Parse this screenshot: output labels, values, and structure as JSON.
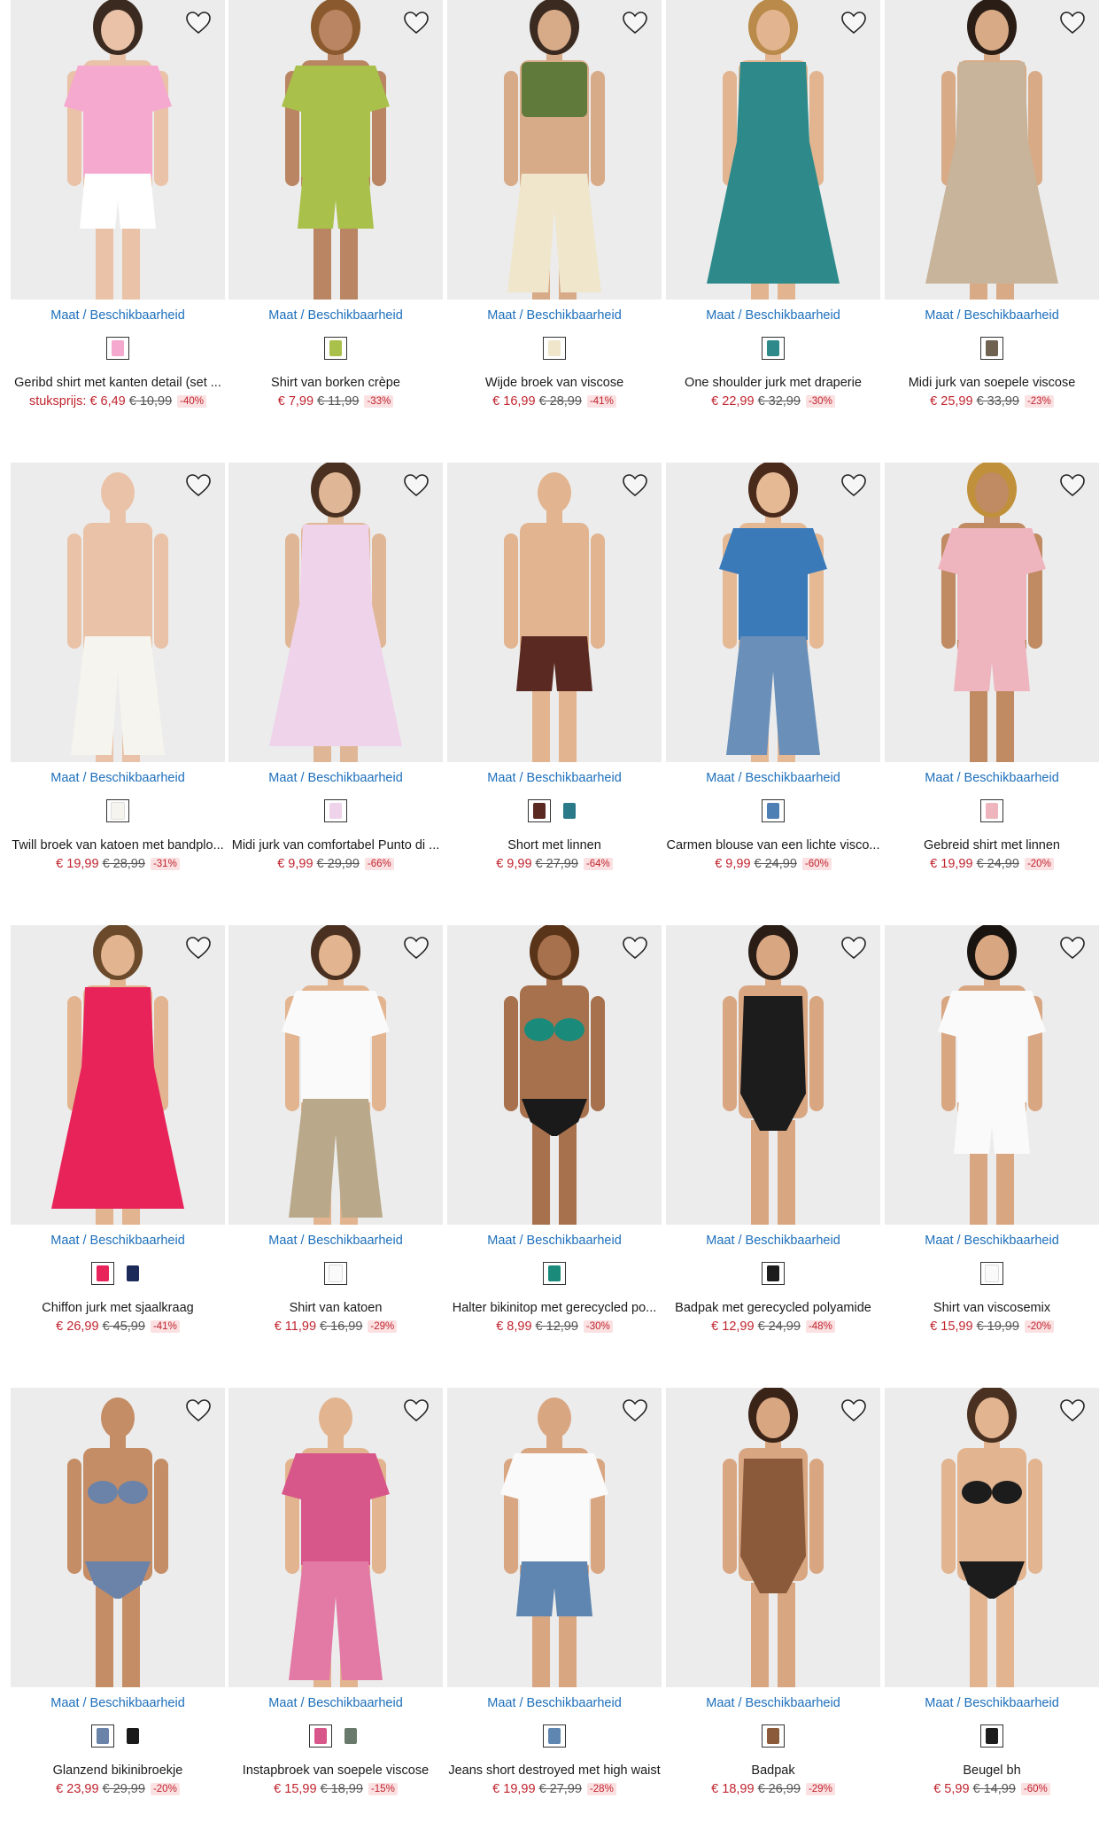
{
  "maat_label": "Maat / Beschikbaarheid",
  "colors": {
    "price_red": "#c0242e",
    "link_blue": "#1d6fbb",
    "discount_bg": "#fbe1e2"
  },
  "products": [
    {
      "name": "Geribd shirt met kanten detail (set ...",
      "prefix": "stuksprijs:",
      "price": "€ 6,49",
      "old_price": "€ 10,99",
      "discount": "-40%",
      "bg": "#ececec",
      "skin": "#e9c2a7",
      "hair": "#3a2a20",
      "top": "#f6a9cf",
      "bottom": "#ffffff",
      "bottom_type": "shorts",
      "top_type": "tee",
      "swatches": [
        "#f6a9cf"
      ]
    },
    {
      "name": "Shirt van borken crèpe",
      "price": "€ 7,99",
      "old_price": "€ 11,99",
      "discount": "-33%",
      "bg": "#ececec",
      "skin": "#b98562",
      "hair": "#8a5a2e",
      "top": "#a9c04a",
      "bottom": "#a9c04a",
      "bottom_type": "shorts",
      "top_type": "tee",
      "swatches": [
        "#a9c04a"
      ]
    },
    {
      "name": "Wijde broek van viscose",
      "price": "€ 16,99",
      "old_price": "€ 28,99",
      "discount": "-41%",
      "bg": "#ececec",
      "skin": "#d7aa88",
      "hair": "#3a2a20",
      "top": "#5f7a3a",
      "bottom": "#efe6cc",
      "bottom_type": "pants",
      "top_type": "cropped",
      "swatches": [
        "#efe6cc"
      ]
    },
    {
      "name": "One shoulder jurk met draperie",
      "price": "€ 22,99",
      "old_price": "€ 32,99",
      "discount": "-30%",
      "bg": "#ececec",
      "skin": "#e2b48f",
      "hair": "#b98a4a",
      "top": "#2e8a8a",
      "bottom": "#2e8a8a",
      "bottom_type": "dress",
      "top_type": "dress",
      "swatches": [
        "#2e8a8a"
      ]
    },
    {
      "name": "Midi jurk van soepele viscose",
      "price": "€ 25,99",
      "old_price": "€ 33,99",
      "discount": "-23%",
      "bg": "#ececec",
      "skin": "#d9aa86",
      "hair": "#2a1d16",
      "top": "#c7b49a",
      "bottom": "#5a4a3a",
      "bottom_type": "dress",
      "top_type": "dress",
      "swatches": [
        "#6f6250"
      ]
    },
    {
      "name": "Twill broek van katoen met bandplo...",
      "price": "€ 19,99",
      "old_price": "€ 28,99",
      "discount": "-31%",
      "bg": "#ececec",
      "skin": "#e9c2a7",
      "hair": "#ececec",
      "top": "#d8c3a5",
      "bottom": "#f6f4ee",
      "bottom_type": "pants",
      "top_type": "none",
      "swatches": [
        "#f6f4ee"
      ]
    },
    {
      "name": "Midi jurk van comfortabel Punto di ...",
      "price": "€ 9,99",
      "old_price": "€ 29,99",
      "discount": "-66%",
      "bg": "#ececec",
      "skin": "#e0b796",
      "hair": "#4a3020",
      "top": "#efd3ea",
      "bottom": "#efd3ea",
      "bottom_type": "dress",
      "top_type": "dress",
      "swatches": [
        "#efd3ea"
      ]
    },
    {
      "name": "Short met linnen",
      "price": "€ 9,99",
      "old_price": "€ 27,99",
      "discount": "-64%",
      "bg": "#ececec",
      "skin": "#e2b48f",
      "hair": "#ececec",
      "top": "#5a2a22",
      "bottom": "#5a2a22",
      "bottom_type": "shorts",
      "top_type": "none",
      "swatches": [
        "#5a2a22",
        "#2a7a8a"
      ]
    },
    {
      "name": "Carmen blouse van een lichte visco...",
      "price": "€ 9,99",
      "old_price": "€ 24,99",
      "discount": "-60%",
      "bg": "#ececec",
      "skin": "#e6b995",
      "hair": "#4a2a1a",
      "top": "#3a7ab8",
      "bottom": "#6a8fb8",
      "bottom_type": "pants",
      "top_type": "tee",
      "swatches": [
        "#4d7fb5"
      ]
    },
    {
      "name": "Gebreid shirt met linnen",
      "price": "€ 19,99",
      "old_price": "€ 24,99",
      "discount": "-20%",
      "bg": "#ececec",
      "skin": "#c08a62",
      "hair": "#c0903a",
      "top": "#eeb5be",
      "bottom": "#eeb5be",
      "bottom_type": "shorts",
      "top_type": "tee",
      "swatches": [
        "#eeb5be"
      ]
    },
    {
      "name": "Chiffon jurk met sjaalkraag",
      "price": "€ 26,99",
      "old_price": "€ 45,99",
      "discount": "-41%",
      "bg": "#ececec",
      "skin": "#e2b48f",
      "hair": "#6a4a2a",
      "top": "#e8235a",
      "bottom": "#e8235a",
      "bottom_type": "dress",
      "top_type": "dress",
      "swatches": [
        "#e8235a",
        "#1c2a5a"
      ]
    },
    {
      "name": "Shirt van katoen",
      "price": "€ 11,99",
      "old_price": "€ 16,99",
      "discount": "-29%",
      "bg": "#ececec",
      "skin": "#e2b48f",
      "hair": "#4a3020",
      "top": "#fafafa",
      "bottom": "#b9a98a",
      "bottom_type": "pants",
      "top_type": "tee",
      "swatches": [
        "#fafafa"
      ]
    },
    {
      "name": "Halter bikinitop met gerecycled po...",
      "price": "€ 8,99",
      "old_price": "€ 12,99",
      "discount": "-30%",
      "bg": "#ececec",
      "skin": "#a8714d",
      "hair": "#5a3418",
      "top": "#1a8a7a",
      "bottom": "#1a1a1a",
      "bottom_type": "bikini",
      "top_type": "bikini",
      "swatches": [
        "#1a8a7a"
      ]
    },
    {
      "name": "Badpak met gerecycled polyamide",
      "price": "€ 12,99",
      "old_price": "€ 24,99",
      "discount": "-48%",
      "bg": "#ececec",
      "skin": "#d9a682",
      "hair": "#2a1d16",
      "top": "#1c1c1c",
      "bottom": "#1c1c1c",
      "bottom_type": "swimsuit",
      "top_type": "swimsuit",
      "swatches": [
        "#1c1c1c"
      ]
    },
    {
      "name": "Shirt van viscosemix",
      "price": "€ 15,99",
      "old_price": "€ 19,99",
      "discount": "-20%",
      "bg": "#ececec",
      "skin": "#d9a682",
      "hair": "#1a1410",
      "top": "#fafafa",
      "bottom": "#fafafa",
      "bottom_type": "shorts",
      "top_type": "tee",
      "swatches": [
        "#fafafa"
      ]
    },
    {
      "name": "Glanzend bikinibroekje",
      "price": "€ 23,99",
      "old_price": "€ 29,99",
      "discount": "-20%",
      "bg": "#ececec",
      "skin": "#c48d66",
      "hair": "#ececec",
      "top": "#6b83a8",
      "bottom": "#6b83a8",
      "bottom_type": "bikini",
      "top_type": "bikini",
      "swatches": [
        "#6b83a8",
        "#1a1a1a"
      ]
    },
    {
      "name": "Instapbroek van soepele viscose",
      "price": "€ 15,99",
      "old_price": "€ 18,99",
      "discount": "-15%",
      "bg": "#ececec",
      "skin": "#e2b48f",
      "hair": "#ececec",
      "top": "#d8578a",
      "bottom": "#e27aa5",
      "bottom_type": "pants",
      "top_type": "tee",
      "swatches": [
        "#d8578a",
        "#6a7a6a"
      ]
    },
    {
      "name": "Jeans short destroyed met high waist",
      "price": "€ 19,99",
      "old_price": "€ 27,99",
      "discount": "-28%",
      "bg": "#ececec",
      "skin": "#d9a682",
      "hair": "#ececec",
      "top": "#fafafa",
      "bottom": "#5f86b0",
      "bottom_type": "shorts",
      "top_type": "tee",
      "swatches": [
        "#5f86b0"
      ]
    },
    {
      "name": "Badpak",
      "price": "€ 18,99",
      "old_price": "€ 26,99",
      "discount": "-29%",
      "bg": "#ececec",
      "skin": "#d9a682",
      "hair": "#3a2418",
      "top": "#8a5a3a",
      "bottom": "#8a5a3a",
      "bottom_type": "swimsuit",
      "top_type": "swimsuit",
      "swatches": [
        "#8a5a3a"
      ]
    },
    {
      "name": "Beugel bh",
      "price": "€ 5,99",
      "old_price": "€ 14,99",
      "discount": "-60%",
      "bg": "#ececec",
      "skin": "#e2b48f",
      "hair": "#4a3020",
      "top": "#1c1c1c",
      "bottom": "#1c1c1c",
      "bottom_type": "bikini",
      "top_type": "bikini",
      "swatches": [
        "#1c1c1c"
      ]
    }
  ]
}
